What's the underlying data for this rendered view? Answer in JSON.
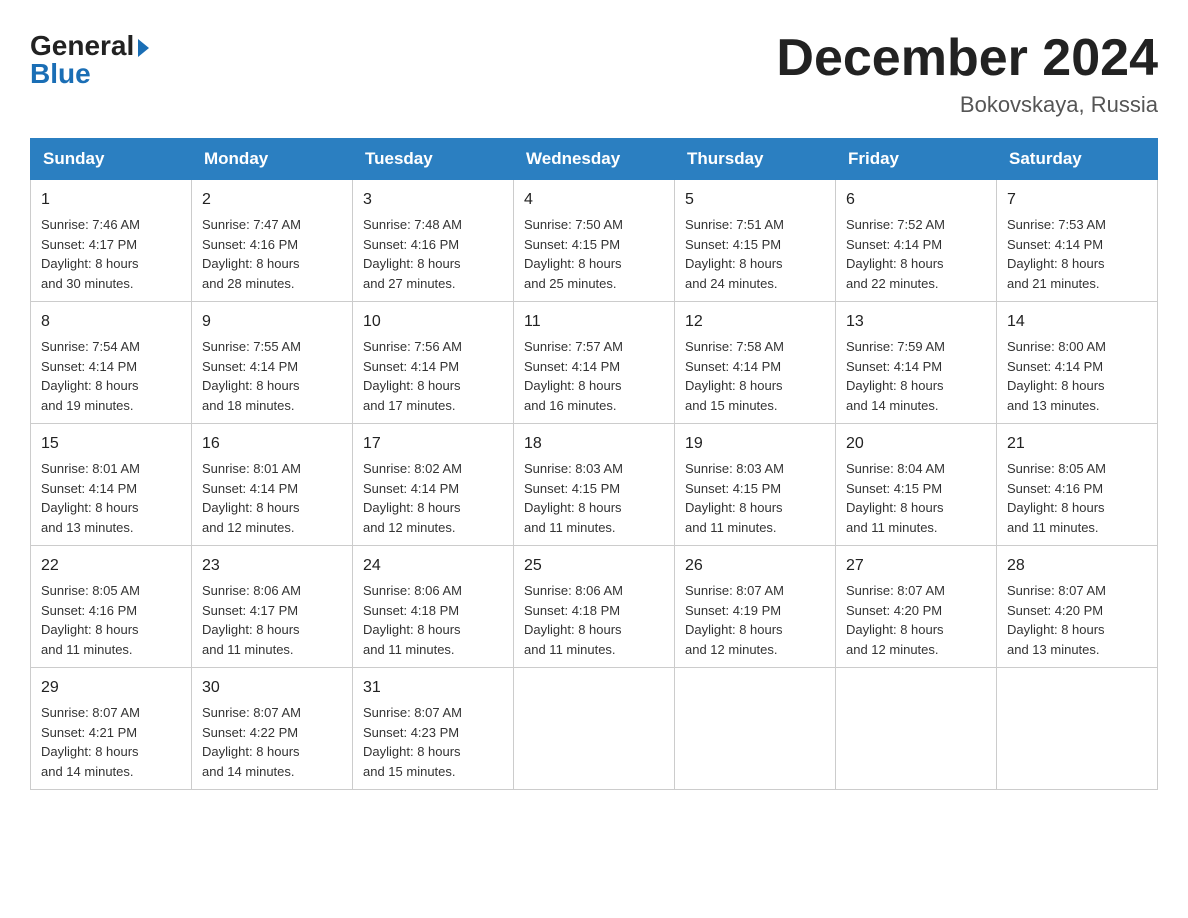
{
  "header": {
    "month_title": "December 2024",
    "location": "Bokovskaya, Russia"
  },
  "days_of_week": [
    "Sunday",
    "Monday",
    "Tuesday",
    "Wednesday",
    "Thursday",
    "Friday",
    "Saturday"
  ],
  "weeks": [
    [
      {
        "day": "1",
        "sunrise": "7:46 AM",
        "sunset": "4:17 PM",
        "daylight": "8 hours and 30 minutes."
      },
      {
        "day": "2",
        "sunrise": "7:47 AM",
        "sunset": "4:16 PM",
        "daylight": "8 hours and 28 minutes."
      },
      {
        "day": "3",
        "sunrise": "7:48 AM",
        "sunset": "4:16 PM",
        "daylight": "8 hours and 27 minutes."
      },
      {
        "day": "4",
        "sunrise": "7:50 AM",
        "sunset": "4:15 PM",
        "daylight": "8 hours and 25 minutes."
      },
      {
        "day": "5",
        "sunrise": "7:51 AM",
        "sunset": "4:15 PM",
        "daylight": "8 hours and 24 minutes."
      },
      {
        "day": "6",
        "sunrise": "7:52 AM",
        "sunset": "4:14 PM",
        "daylight": "8 hours and 22 minutes."
      },
      {
        "day": "7",
        "sunrise": "7:53 AM",
        "sunset": "4:14 PM",
        "daylight": "8 hours and 21 minutes."
      }
    ],
    [
      {
        "day": "8",
        "sunrise": "7:54 AM",
        "sunset": "4:14 PM",
        "daylight": "8 hours and 19 minutes."
      },
      {
        "day": "9",
        "sunrise": "7:55 AM",
        "sunset": "4:14 PM",
        "daylight": "8 hours and 18 minutes."
      },
      {
        "day": "10",
        "sunrise": "7:56 AM",
        "sunset": "4:14 PM",
        "daylight": "8 hours and 17 minutes."
      },
      {
        "day": "11",
        "sunrise": "7:57 AM",
        "sunset": "4:14 PM",
        "daylight": "8 hours and 16 minutes."
      },
      {
        "day": "12",
        "sunrise": "7:58 AM",
        "sunset": "4:14 PM",
        "daylight": "8 hours and 15 minutes."
      },
      {
        "day": "13",
        "sunrise": "7:59 AM",
        "sunset": "4:14 PM",
        "daylight": "8 hours and 14 minutes."
      },
      {
        "day": "14",
        "sunrise": "8:00 AM",
        "sunset": "4:14 PM",
        "daylight": "8 hours and 13 minutes."
      }
    ],
    [
      {
        "day": "15",
        "sunrise": "8:01 AM",
        "sunset": "4:14 PM",
        "daylight": "8 hours and 13 minutes."
      },
      {
        "day": "16",
        "sunrise": "8:01 AM",
        "sunset": "4:14 PM",
        "daylight": "8 hours and 12 minutes."
      },
      {
        "day": "17",
        "sunrise": "8:02 AM",
        "sunset": "4:14 PM",
        "daylight": "8 hours and 12 minutes."
      },
      {
        "day": "18",
        "sunrise": "8:03 AM",
        "sunset": "4:15 PM",
        "daylight": "8 hours and 11 minutes."
      },
      {
        "day": "19",
        "sunrise": "8:03 AM",
        "sunset": "4:15 PM",
        "daylight": "8 hours and 11 minutes."
      },
      {
        "day": "20",
        "sunrise": "8:04 AM",
        "sunset": "4:15 PM",
        "daylight": "8 hours and 11 minutes."
      },
      {
        "day": "21",
        "sunrise": "8:05 AM",
        "sunset": "4:16 PM",
        "daylight": "8 hours and 11 minutes."
      }
    ],
    [
      {
        "day": "22",
        "sunrise": "8:05 AM",
        "sunset": "4:16 PM",
        "daylight": "8 hours and 11 minutes."
      },
      {
        "day": "23",
        "sunrise": "8:06 AM",
        "sunset": "4:17 PM",
        "daylight": "8 hours and 11 minutes."
      },
      {
        "day": "24",
        "sunrise": "8:06 AM",
        "sunset": "4:18 PM",
        "daylight": "8 hours and 11 minutes."
      },
      {
        "day": "25",
        "sunrise": "8:06 AM",
        "sunset": "4:18 PM",
        "daylight": "8 hours and 11 minutes."
      },
      {
        "day": "26",
        "sunrise": "8:07 AM",
        "sunset": "4:19 PM",
        "daylight": "8 hours and 12 minutes."
      },
      {
        "day": "27",
        "sunrise": "8:07 AM",
        "sunset": "4:20 PM",
        "daylight": "8 hours and 12 minutes."
      },
      {
        "day": "28",
        "sunrise": "8:07 AM",
        "sunset": "4:20 PM",
        "daylight": "8 hours and 13 minutes."
      }
    ],
    [
      {
        "day": "29",
        "sunrise": "8:07 AM",
        "sunset": "4:21 PM",
        "daylight": "8 hours and 14 minutes."
      },
      {
        "day": "30",
        "sunrise": "8:07 AM",
        "sunset": "4:22 PM",
        "daylight": "8 hours and 14 minutes."
      },
      {
        "day": "31",
        "sunrise": "8:07 AM",
        "sunset": "4:23 PM",
        "daylight": "8 hours and 15 minutes."
      },
      null,
      null,
      null,
      null
    ]
  ]
}
